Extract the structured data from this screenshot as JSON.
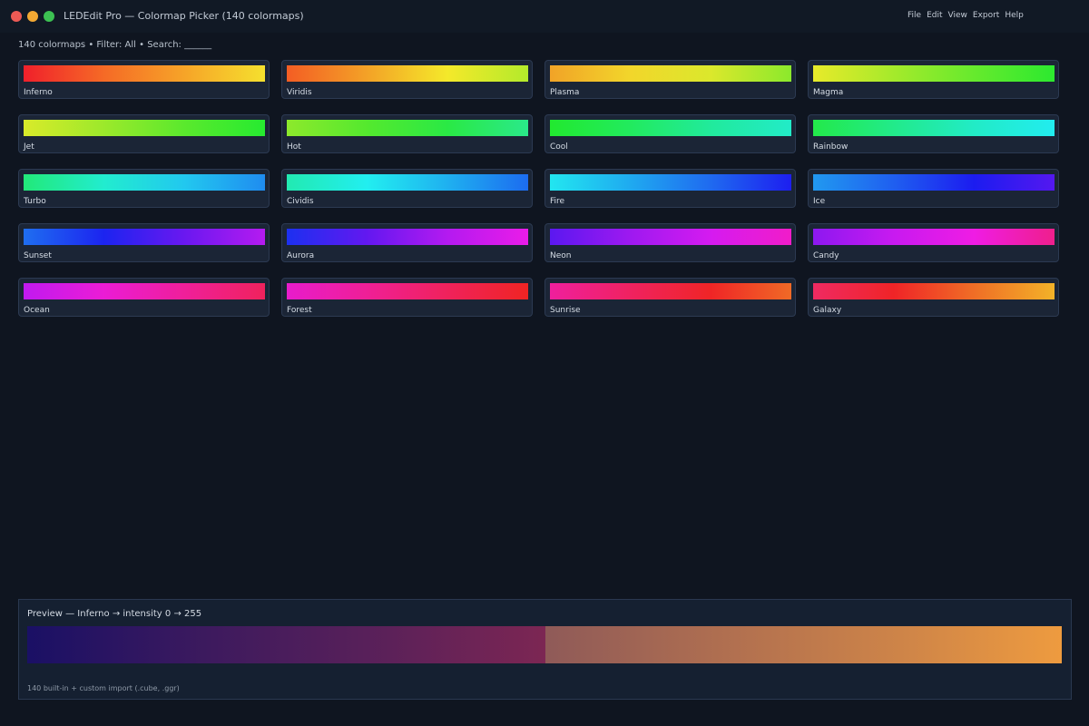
{
  "window": {
    "title": "LEDEdit Pro — Colormap Picker (140 colormaps)",
    "menu": [
      "File",
      "Edit",
      "View",
      "Export",
      "Help"
    ]
  },
  "status": {
    "text": "140 colormaps  •  Filter: All  •  Search: ______"
  },
  "colormaps": [
    {
      "name": "Inferno",
      "stops": [
        "#f0202b",
        "#f56a26",
        "#f6a428",
        "#f5e02e"
      ]
    },
    {
      "name": "Viridis",
      "stops": [
        "#f35d24",
        "#f3a227",
        "#f4e92a",
        "#b3ea2b"
      ]
    },
    {
      "name": "Plasma",
      "stops": [
        "#f1a327",
        "#f2d62b",
        "#dbe82c",
        "#8be92c"
      ]
    },
    {
      "name": "Magma",
      "stops": [
        "#e8ea2a",
        "#a5ea2b",
        "#66ea2d",
        "#2ce92f"
      ]
    },
    {
      "name": "Jet",
      "stops": [
        "#d9ea2a",
        "#9ce92b",
        "#5ae92d",
        "#26ea30"
      ]
    },
    {
      "name": "Hot",
      "stops": [
        "#8de92c",
        "#54e92e",
        "#2ae945",
        "#2ae98a"
      ]
    },
    {
      "name": "Cool",
      "stops": [
        "#22e92f",
        "#22ea5e",
        "#21ea9c",
        "#22ebc8"
      ]
    },
    {
      "name": "Rainbow",
      "stops": [
        "#23e94a",
        "#22ea8a",
        "#22ebc6",
        "#22ecef"
      ]
    },
    {
      "name": "Turbo",
      "stops": [
        "#22e979",
        "#22eccf",
        "#22c8ef",
        "#1f8cf0"
      ]
    },
    {
      "name": "Cividis",
      "stops": [
        "#22eab1",
        "#22eef0",
        "#1fb0f0",
        "#1c6cf0"
      ]
    },
    {
      "name": "Fire",
      "stops": [
        "#22e6f0",
        "#1faaf0",
        "#1f6af0",
        "#1d1ef0"
      ]
    },
    {
      "name": "Ice",
      "stops": [
        "#2199f0",
        "#1f5ff0",
        "#1c1cf0",
        "#5418f0"
      ]
    },
    {
      "name": "Sunset",
      "stops": [
        "#1f6ef0",
        "#1c24f0",
        "#6a18f0",
        "#b51bf0"
      ]
    },
    {
      "name": "Aurora",
      "stops": [
        "#1c30f0",
        "#6318f0",
        "#b41af0",
        "#ea1ce8"
      ]
    },
    {
      "name": "Neon",
      "stops": [
        "#5b18f0",
        "#9e19f0",
        "#d51bf0",
        "#f11cc9"
      ]
    },
    {
      "name": "Candy",
      "stops": [
        "#8d18f0",
        "#c81af0",
        "#ef1ce4",
        "#ef1f8c"
      ]
    },
    {
      "name": "Ocean",
      "stops": [
        "#c11af0",
        "#eb1cd5",
        "#ef1f9a",
        "#f0225c"
      ]
    },
    {
      "name": "Forest",
      "stops": [
        "#e81ccc",
        "#ef1f96",
        "#ef225b",
        "#ef2423"
      ]
    },
    {
      "name": "Sunrise",
      "stops": [
        "#ef1f9d",
        "#f02260",
        "#ef2526",
        "#f06a26"
      ]
    },
    {
      "name": "Galaxy",
      "stops": [
        "#ef2a62",
        "#ef2427",
        "#f06e26",
        "#f2b228"
      ]
    }
  ],
  "preview": {
    "title": "Preview — Inferno  →  intensity 0 → 255",
    "footer": "140 built-in + custom import (.cube, .ggr)"
  }
}
